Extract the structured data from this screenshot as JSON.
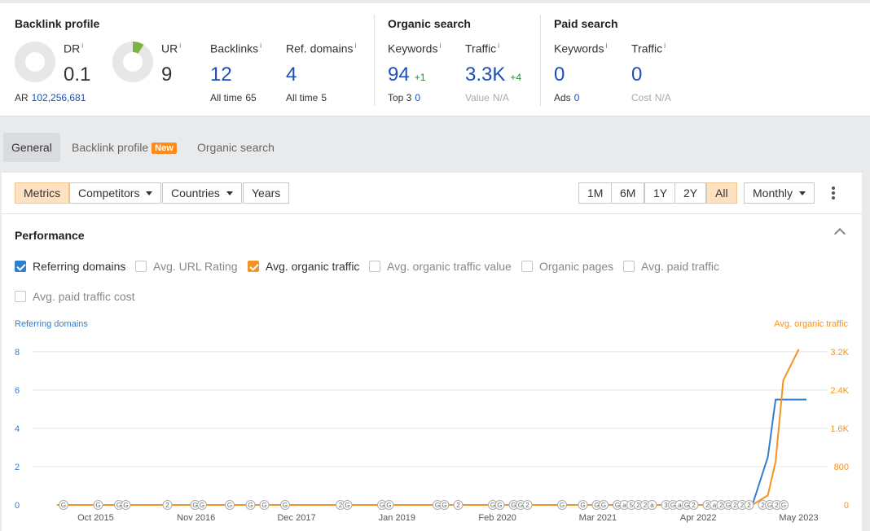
{
  "backlink_profile": {
    "title": "Backlink profile",
    "dr": {
      "label": "DR",
      "value": "0.1"
    },
    "ur": {
      "label": "UR",
      "value": "9"
    },
    "ar": {
      "label": "AR",
      "value": "102,256,681"
    },
    "backlinks": {
      "label": "Backlinks",
      "value": "12",
      "sub_label": "All time",
      "sub_value": "65"
    },
    "ref_domains": {
      "label": "Ref. domains",
      "value": "4",
      "sub_label": "All time",
      "sub_value": "5"
    }
  },
  "organic_search": {
    "title": "Organic search",
    "keywords": {
      "label": "Keywords",
      "value": "94",
      "delta": "+1",
      "sub_label": "Top 3",
      "sub_value": "0"
    },
    "traffic": {
      "label": "Traffic",
      "value": "3.3K",
      "delta": "+4",
      "sub_label": "Value",
      "sub_value": "N/A"
    }
  },
  "paid_search": {
    "title": "Paid search",
    "keywords": {
      "label": "Keywords",
      "value": "0",
      "sub_label": "Ads",
      "sub_value": "0"
    },
    "traffic": {
      "label": "Traffic",
      "value": "0",
      "sub_label": "Cost",
      "sub_value": "N/A"
    }
  },
  "info_mark": "i",
  "tabs": [
    {
      "label": "General",
      "active": true
    },
    {
      "label": "Backlink profile",
      "badge": "New"
    },
    {
      "label": "Organic search"
    }
  ],
  "toolbar": {
    "views": [
      "Metrics",
      "Competitors",
      "Countries",
      "Years"
    ],
    "ranges": [
      "1M",
      "6M",
      "1Y",
      "2Y",
      "All"
    ],
    "selected_range": "All",
    "interval": "Monthly"
  },
  "performance": {
    "title": "Performance",
    "checkboxes": [
      {
        "label": "Referring domains",
        "checked": true,
        "color": "#2f7fd1"
      },
      {
        "label": "Avg. URL Rating",
        "checked": false
      },
      {
        "label": "Avg. organic traffic",
        "checked": true,
        "color": "#f39322"
      },
      {
        "label": "Avg. organic traffic value",
        "checked": false
      },
      {
        "label": "Organic pages",
        "checked": false
      },
      {
        "label": "Avg. paid traffic",
        "checked": false
      },
      {
        "label": "Avg. paid traffic cost",
        "checked": false
      }
    ]
  },
  "chart_data": {
    "type": "line",
    "left_axis_title": "Referring domains",
    "right_axis_title": "Avg. organic traffic",
    "left_axis": {
      "ticks": [
        "0",
        "2",
        "4",
        "6",
        "8"
      ],
      "range": [
        0,
        8.8
      ],
      "color": "#2f7fd1"
    },
    "right_axis": {
      "ticks": [
        "0",
        "800",
        "1.6K",
        "2.4K",
        "3.2K"
      ],
      "range": [
        0,
        3520
      ],
      "color": "#f39322"
    },
    "x_labels": [
      "Oct 2015",
      "Nov 2016",
      "Dec 2017",
      "Jan 2019",
      "Feb 2020",
      "Mar 2021",
      "Apr 2022",
      "May 2023"
    ],
    "x_range": [
      "2015-05",
      "2023-06"
    ],
    "series": [
      {
        "name": "Referring domains",
        "color": "#2f7fd1",
        "axis": "left",
        "points": [
          [
            "2015-05",
            0
          ],
          [
            "2022-11",
            0
          ],
          [
            "2023-01",
            2.5
          ],
          [
            "2023-02",
            5.5
          ],
          [
            "2023-06",
            5.5
          ]
        ]
      },
      {
        "name": "Avg. organic traffic",
        "color": "#f39322",
        "axis": "right",
        "points": [
          [
            "2015-05",
            0
          ],
          [
            "2022-11",
            0
          ],
          [
            "2023-01",
            200
          ],
          [
            "2023-02",
            900
          ],
          [
            "2023-03",
            2600
          ],
          [
            "2023-05",
            3250
          ]
        ]
      }
    ],
    "annotations": [
      {
        "d": "2015-08",
        "t": "G"
      },
      {
        "d": "2016-01",
        "t": "G"
      },
      {
        "d": "2016-04",
        "t": "G"
      },
      {
        "d": "2016-05",
        "t": "G"
      },
      {
        "d": "2016-11",
        "t": "2"
      },
      {
        "d": "2017-03",
        "t": "G"
      },
      {
        "d": "2017-04",
        "t": "G"
      },
      {
        "d": "2017-08",
        "t": "G"
      },
      {
        "d": "2017-11",
        "t": "G"
      },
      {
        "d": "2018-01",
        "t": "G"
      },
      {
        "d": "2018-04",
        "t": "G"
      },
      {
        "d": "2018-12",
        "t": "2"
      },
      {
        "d": "2019-01",
        "t": "G"
      },
      {
        "d": "2019-06",
        "t": "G"
      },
      {
        "d": "2019-07",
        "t": "G"
      },
      {
        "d": "2020-02",
        "t": "G"
      },
      {
        "d": "2020-03",
        "t": "G"
      },
      {
        "d": "2020-05",
        "t": "2"
      },
      {
        "d": "2020-10",
        "t": "G"
      },
      {
        "d": "2020-11",
        "t": "G"
      },
      {
        "d": "2021-01",
        "t": "G"
      },
      {
        "d": "2021-02",
        "t": "G"
      },
      {
        "d": "2021-03",
        "t": "2"
      },
      {
        "d": "2021-08",
        "t": "G"
      },
      {
        "d": "2021-11",
        "t": "G"
      },
      {
        "d": "2022-01",
        "t": "G"
      },
      {
        "d": "2022-02",
        "t": "G"
      },
      {
        "d": "2022-04",
        "t": "G"
      },
      {
        "d": "2022-05",
        "t": "a"
      },
      {
        "d": "2022-06",
        "t": "5"
      },
      {
        "d": "2022-07",
        "t": "2"
      },
      {
        "d": "2022-08",
        "t": "2"
      },
      {
        "d": "2022-09",
        "t": "a"
      },
      {
        "d": "2022-11",
        "t": "3"
      },
      {
        "d": "2022-12",
        "t": "G"
      },
      {
        "d": "2023-01",
        "t": "a"
      },
      {
        "d": "2023-02",
        "t": "G"
      },
      {
        "d": "2023-03",
        "t": "2"
      },
      {
        "d": "2023-05",
        "t": "2"
      },
      {
        "d": "2023-06",
        "t": "a"
      },
      {
        "d": "2023-07",
        "t": "2"
      },
      {
        "d": "2023-08",
        "t": "G"
      },
      {
        "d": "2023-09",
        "t": "2"
      },
      {
        "d": "2023-10",
        "t": "2"
      },
      {
        "d": "2023-11",
        "t": "2"
      },
      {
        "d": "2024-01",
        "t": "2"
      },
      {
        "d": "2024-02",
        "t": "G"
      },
      {
        "d": "2024-03",
        "t": "2"
      },
      {
        "d": "2024-04",
        "t": "G"
      }
    ],
    "grid": true
  }
}
